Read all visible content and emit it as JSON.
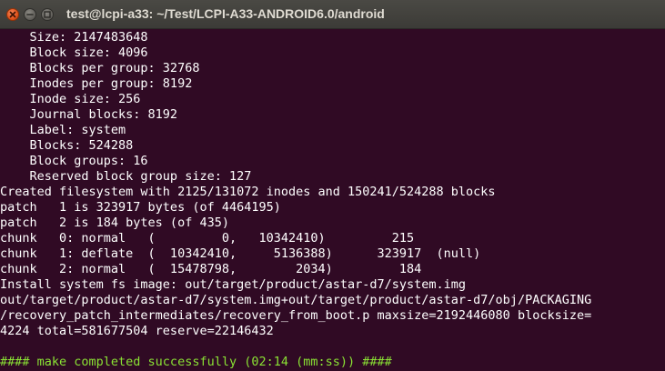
{
  "window": {
    "title": "test@lcpi-a33: ~/Test/LCPI-A33-ANDROID6.0/android",
    "buttons": {
      "close_icon": "close-icon",
      "minimize_icon": "minimize-icon",
      "maximize_icon": "maximize-icon"
    }
  },
  "colors": {
    "background": "#300a24",
    "foreground": "#ffffff",
    "success": "#8ae234",
    "close_button": "#e2531c"
  },
  "terminal": {
    "lines": [
      {
        "text": "    Size: 2147483648",
        "style": "normal"
      },
      {
        "text": "    Block size: 4096",
        "style": "normal"
      },
      {
        "text": "    Blocks per group: 32768",
        "style": "normal"
      },
      {
        "text": "    Inodes per group: 8192",
        "style": "normal"
      },
      {
        "text": "    Inode size: 256",
        "style": "normal"
      },
      {
        "text": "    Journal blocks: 8192",
        "style": "normal"
      },
      {
        "text": "    Label: system",
        "style": "normal"
      },
      {
        "text": "    Blocks: 524288",
        "style": "normal"
      },
      {
        "text": "    Block groups: 16",
        "style": "normal"
      },
      {
        "text": "    Reserved block group size: 127",
        "style": "normal"
      },
      {
        "text": "Created filesystem with 2125/131072 inodes and 150241/524288 blocks",
        "style": "normal"
      },
      {
        "text": "patch   1 is 323917 bytes (of 4464195)",
        "style": "normal"
      },
      {
        "text": "patch   2 is 184 bytes (of 435)",
        "style": "normal"
      },
      {
        "text": "chunk   0: normal   (         0,   10342410)         215",
        "style": "normal"
      },
      {
        "text": "chunk   1: deflate  (  10342410,     5136388)      323917  (null)",
        "style": "normal"
      },
      {
        "text": "chunk   2: normal   (  15478798,        2034)         184",
        "style": "normal"
      },
      {
        "text": "Install system fs image: out/target/product/astar-d7/system.img",
        "style": "normal"
      },
      {
        "text": "out/target/product/astar-d7/system.img+out/target/product/astar-d7/obj/PACKAGING",
        "style": "normal"
      },
      {
        "text": "/recovery_patch_intermediates/recovery_from_boot.p maxsize=2192446080 blocksize=",
        "style": "normal"
      },
      {
        "text": "4224 total=581677504 reserve=22146432",
        "style": "normal"
      },
      {
        "text": "",
        "style": "blank"
      },
      {
        "text": "#### make completed successfully (02:14 (mm:ss)) ####",
        "style": "success"
      }
    ]
  }
}
